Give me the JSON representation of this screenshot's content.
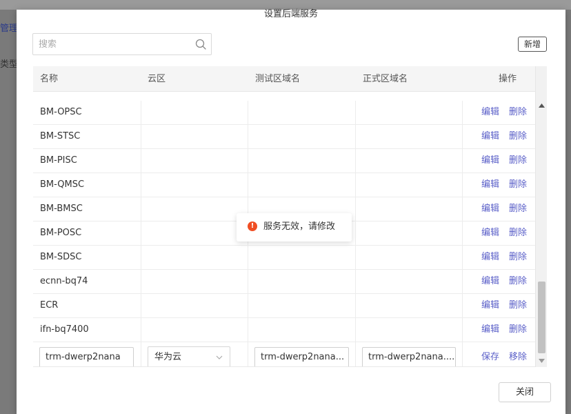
{
  "background": {
    "side_link_1": "管理",
    "side_text_2": "类型"
  },
  "dialog": {
    "title": "设置后端服务",
    "search": {
      "placeholder": "搜索",
      "value": ""
    },
    "add_button": "新增",
    "close_button": "关闭"
  },
  "table": {
    "columns": [
      "名称",
      "云区",
      "测试区域名",
      "正式区域名",
      "操作"
    ],
    "rows": [
      {
        "name": "BM-OPSC",
        "cloud": "",
        "test_domain": "",
        "prod_domain": "",
        "edit": "编辑",
        "delete": "删除"
      },
      {
        "name": "BM-STSC",
        "cloud": "",
        "test_domain": "",
        "prod_domain": "",
        "edit": "编辑",
        "delete": "删除"
      },
      {
        "name": "BM-PISC",
        "cloud": "",
        "test_domain": "",
        "prod_domain": "",
        "edit": "编辑",
        "delete": "删除"
      },
      {
        "name": "BM-QMSC",
        "cloud": "",
        "test_domain": "",
        "prod_domain": "",
        "edit": "编辑",
        "delete": "删除"
      },
      {
        "name": "BM-BMSC",
        "cloud": "",
        "test_domain": "",
        "prod_domain": "",
        "edit": "编辑",
        "delete": "删除"
      },
      {
        "name": "BM-POSC",
        "cloud": "",
        "test_domain": "",
        "prod_domain": "",
        "edit": "编辑",
        "delete": "删除"
      },
      {
        "name": "BM-SDSC",
        "cloud": "",
        "test_domain": "",
        "prod_domain": "",
        "edit": "编辑",
        "delete": "删除"
      },
      {
        "name": "ecnn-bq74",
        "cloud": "",
        "test_domain": "",
        "prod_domain": "",
        "edit": "编辑",
        "delete": "删除"
      },
      {
        "name": "ECR",
        "cloud": "",
        "test_domain": "",
        "prod_domain": "",
        "edit": "编辑",
        "delete": "删除"
      },
      {
        "name": "ifn-bq7400",
        "cloud": "",
        "test_domain": "",
        "prod_domain": "",
        "edit": "编辑",
        "delete": "删除"
      }
    ],
    "edit_row": {
      "name_value": "trm-dwerp2nana",
      "cloud_value": "华为云",
      "test_domain_value": "trm-dwerp2nana...",
      "prod_domain_value": "trm-dwerp2nana....",
      "save": "保存",
      "remove": "移除"
    }
  },
  "toast": {
    "message": "服务无效，请修改",
    "icon_glyph": "!",
    "icon_color": "#f04e23"
  },
  "colors": {
    "link": "#5a5fc8",
    "header_bg": "#f5f5f5",
    "overlay": "#7a7a7a"
  }
}
